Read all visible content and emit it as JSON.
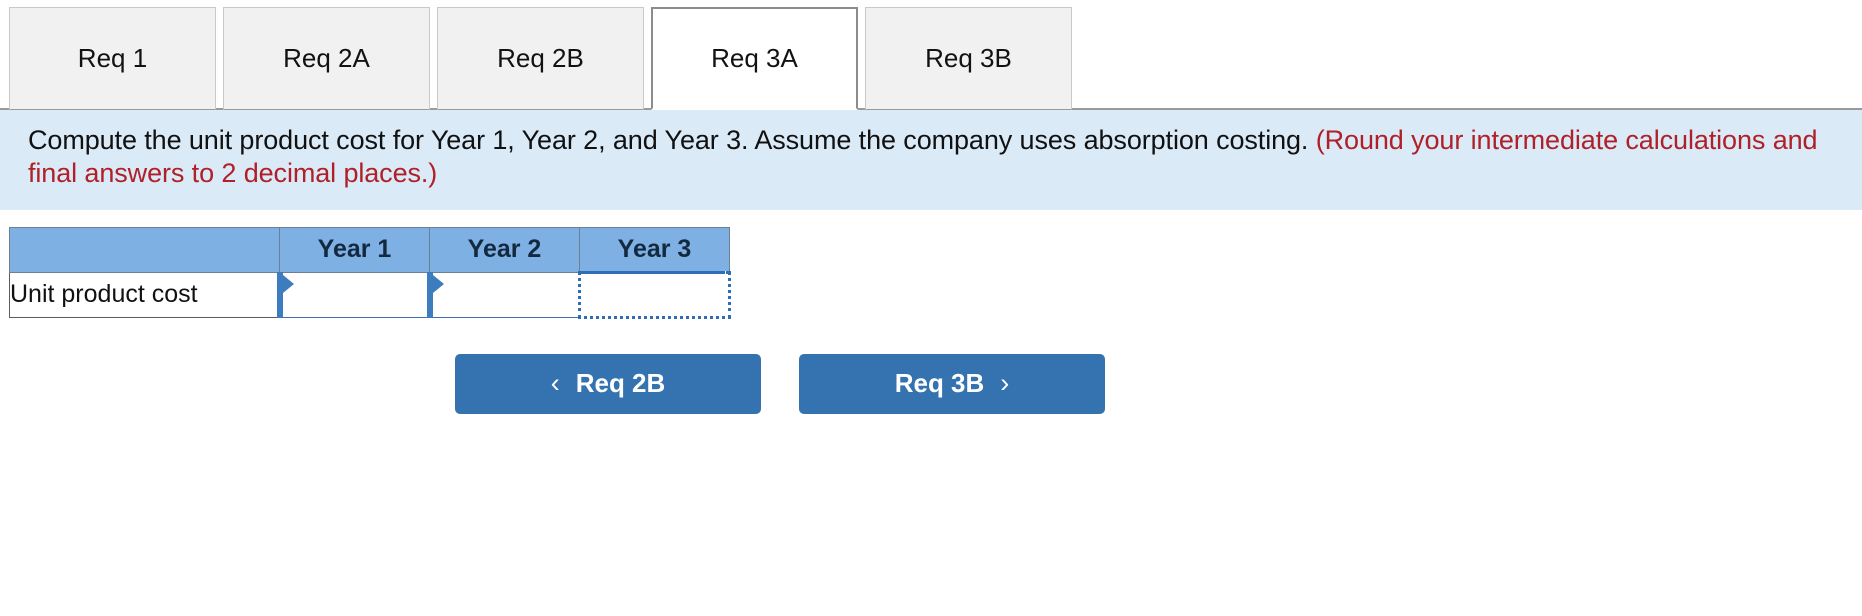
{
  "tabs": [
    {
      "label": "Req 1",
      "active": false
    },
    {
      "label": "Req 2A",
      "active": false
    },
    {
      "label": "Req 2B",
      "active": false
    },
    {
      "label": "Req 3A",
      "active": true
    },
    {
      "label": "Req 3B",
      "active": false
    }
  ],
  "instructions": {
    "main": "Compute the unit product cost for Year 1, Year 2, and Year 3. Assume the company uses absorption costing. ",
    "note": "(Round your intermediate calculations and final answers to 2 decimal places.)"
  },
  "table": {
    "headers": [
      "",
      "Year 1",
      "Year 2",
      "Year 3"
    ],
    "rows": [
      {
        "label": "Unit product cost",
        "values": [
          "",
          "",
          ""
        ]
      }
    ]
  },
  "nav": {
    "prev_label": "Req 2B",
    "prev_icon": "chevron-left",
    "prev_glyph": "‹",
    "next_label": "Req 3B",
    "next_icon": "chevron-right",
    "next_glyph": "›"
  },
  "colors": {
    "header_blue": "#7fb0e4",
    "panel_blue": "#daeaf7",
    "note_red": "#b02028",
    "button_blue": "#3572b0",
    "cell_accent": "#3e7cc0",
    "selection_blue": "#2f6db5"
  }
}
